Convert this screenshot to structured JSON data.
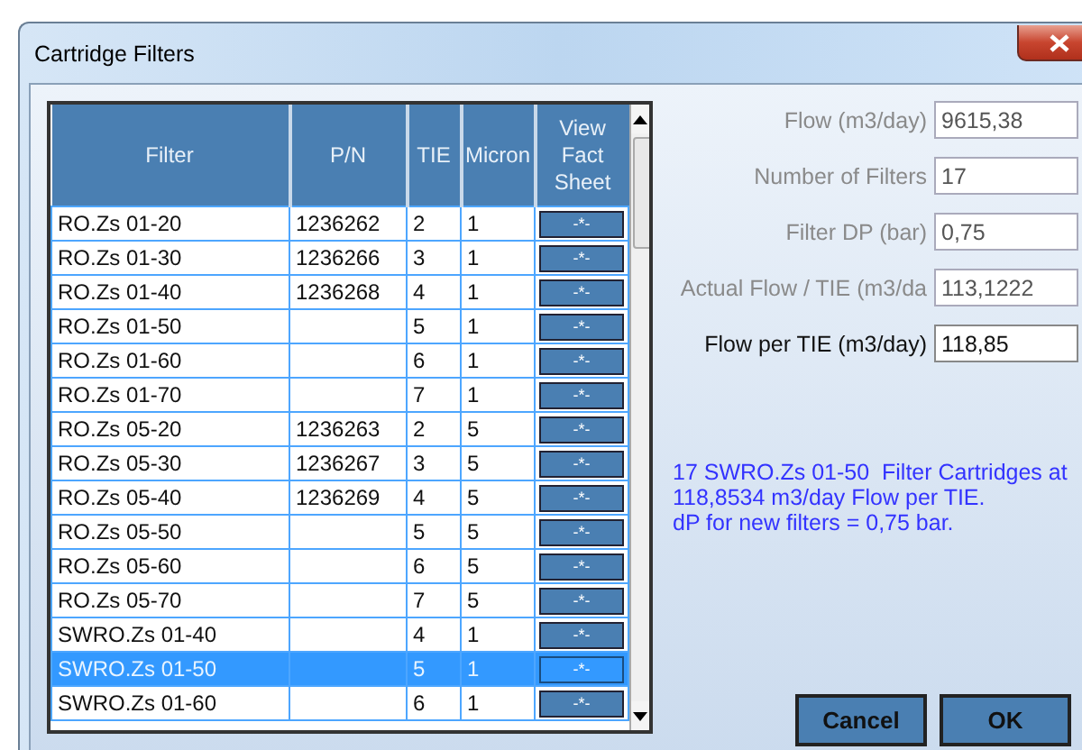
{
  "window": {
    "title": "Cartridge Filters"
  },
  "table": {
    "columns": [
      "Filter",
      "P/N",
      "TIE",
      "Micron",
      "View Fact Sheet"
    ],
    "rows": [
      {
        "filter": "RO.Zs 01-20",
        "pn": "1236262",
        "tie": "2",
        "micron": "1",
        "sheet": "-*-",
        "selected": false
      },
      {
        "filter": "RO.Zs 01-30",
        "pn": "1236266",
        "tie": "3",
        "micron": "1",
        "sheet": "-*-",
        "selected": false
      },
      {
        "filter": "RO.Zs 01-40",
        "pn": "1236268",
        "tie": "4",
        "micron": "1",
        "sheet": "-*-",
        "selected": false
      },
      {
        "filter": "RO.Zs 01-50",
        "pn": "",
        "tie": "5",
        "micron": "1",
        "sheet": "-*-",
        "selected": false
      },
      {
        "filter": "RO.Zs 01-60",
        "pn": "",
        "tie": "6",
        "micron": "1",
        "sheet": "-*-",
        "selected": false
      },
      {
        "filter": "RO.Zs 01-70",
        "pn": "",
        "tie": "7",
        "micron": "1",
        "sheet": "-*-",
        "selected": false
      },
      {
        "filter": "RO.Zs 05-20",
        "pn": "1236263",
        "tie": "2",
        "micron": "5",
        "sheet": "-*-",
        "selected": false
      },
      {
        "filter": "RO.Zs 05-30",
        "pn": "1236267",
        "tie": "3",
        "micron": "5",
        "sheet": "-*-",
        "selected": false
      },
      {
        "filter": "RO.Zs 05-40",
        "pn": "1236269",
        "tie": "4",
        "micron": "5",
        "sheet": "-*-",
        "selected": false
      },
      {
        "filter": "RO.Zs 05-50",
        "pn": "",
        "tie": "5",
        "micron": "5",
        "sheet": "-*-",
        "selected": false
      },
      {
        "filter": "RO.Zs 05-60",
        "pn": "",
        "tie": "6",
        "micron": "5",
        "sheet": "-*-",
        "selected": false
      },
      {
        "filter": "RO.Zs 05-70",
        "pn": "",
        "tie": "7",
        "micron": "5",
        "sheet": "-*-",
        "selected": false
      },
      {
        "filter": "SWRO.Zs 01-40",
        "pn": "",
        "tie": "4",
        "micron": "1",
        "sheet": "-*-",
        "selected": false
      },
      {
        "filter": "SWRO.Zs 01-50",
        "pn": "",
        "tie": "5",
        "micron": "1",
        "sheet": "-*-",
        "selected": true
      },
      {
        "filter": "SWRO.Zs 01-60",
        "pn": "",
        "tie": "6",
        "micron": "1",
        "sheet": "-*-",
        "selected": false
      }
    ]
  },
  "fields": [
    {
      "label": "Flow (m3/day)",
      "value": "9615,38",
      "disabled": true
    },
    {
      "label": "Number of Filters",
      "value": "17",
      "disabled": true
    },
    {
      "label": "Filter DP (bar)",
      "value": "0,75",
      "disabled": true
    },
    {
      "label": "Actual Flow / TIE (m3/da",
      "value": "113,1222",
      "disabled": true
    },
    {
      "label": "Flow per TIE (m3/day)",
      "value": "118,85",
      "disabled": false
    }
  ],
  "message": "17 SWRO.Zs 01-50  Filter Cartridges at\n118,8534 m3/day Flow per TIE.\ndP for new filters = 0,75 bar.",
  "buttons": [
    "Cancel",
    "OK"
  ]
}
